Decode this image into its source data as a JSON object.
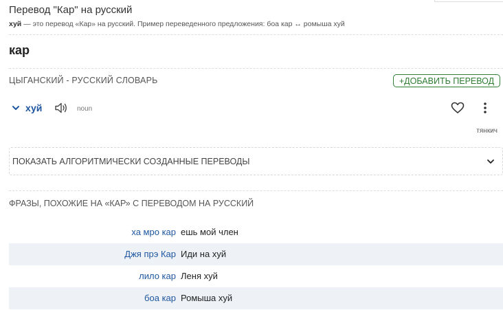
{
  "header": {
    "title": "Перевод \"Кар\" на русский",
    "subtitle_bold": "хуй",
    "subtitle_rest": " — это перевод «Кар» на русский. Пример переведенного предложения: боа кар ↔ ромыша хуй"
  },
  "entry": {
    "word": "кар",
    "dictionary_title": "ЦЫГАНСКИЙ - РУССКИЙ СЛОВАРЬ",
    "add_button": "+ДОБАВИТЬ ПЕРЕВОД"
  },
  "translation": {
    "word": "хуй",
    "pos": "noun",
    "author": "тянкич"
  },
  "algo": {
    "label": "ПОКАЗАТЬ АЛГОРИТМИЧЕСКИ СОЗДАННЫЕ ПЕРЕВОДЫ"
  },
  "phrases": {
    "title": "ФРАЗЫ, ПОХОЖИЕ НА «КАР» С ПЕРЕВОДОМ НА РУССКИЙ",
    "rows": [
      {
        "src": "ха мро кар",
        "dst": "ешь мой член"
      },
      {
        "src": "Джя прэ Кар",
        "dst": "Иди на хуй"
      },
      {
        "src": "лило кар",
        "dst": "Леня хуй"
      },
      {
        "src": "боа кар",
        "dst": "Ромыша хуй"
      }
    ]
  },
  "colors": {
    "link_blue": "#1e56a0",
    "accent_green": "#2e7d32",
    "row_alt_bg": "#eef2f7"
  },
  "icons": [
    "chevron-down-icon",
    "speaker-icon",
    "heart-icon",
    "kebab-menu-icon",
    "chevron-down-icon"
  ]
}
